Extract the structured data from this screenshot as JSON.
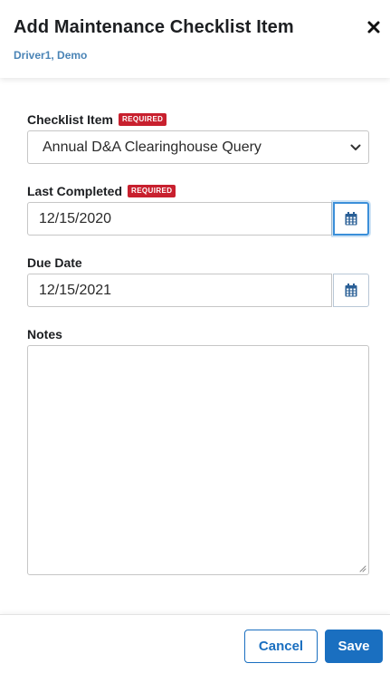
{
  "header": {
    "title": "Add Maintenance Checklist Item",
    "subtitle": "Driver1, Demo",
    "close_icon": "close-icon"
  },
  "form": {
    "checklist_item": {
      "label": "Checklist Item",
      "required_badge": "REQUIRED",
      "selected_value": "Annual D&A Clearinghouse Query"
    },
    "last_completed": {
      "label": "Last Completed",
      "required_badge": "REQUIRED",
      "value": "12/15/2020",
      "icon": "calendar-icon"
    },
    "due_date": {
      "label": "Due Date",
      "value": "12/15/2021",
      "icon": "calendar-icon"
    },
    "notes": {
      "label": "Notes",
      "value": ""
    }
  },
  "footer": {
    "cancel_label": "Cancel",
    "save_label": "Save"
  },
  "colors": {
    "accent": "#1a6fc0",
    "subtitle": "#4a84b6",
    "required": "#c8202e"
  }
}
